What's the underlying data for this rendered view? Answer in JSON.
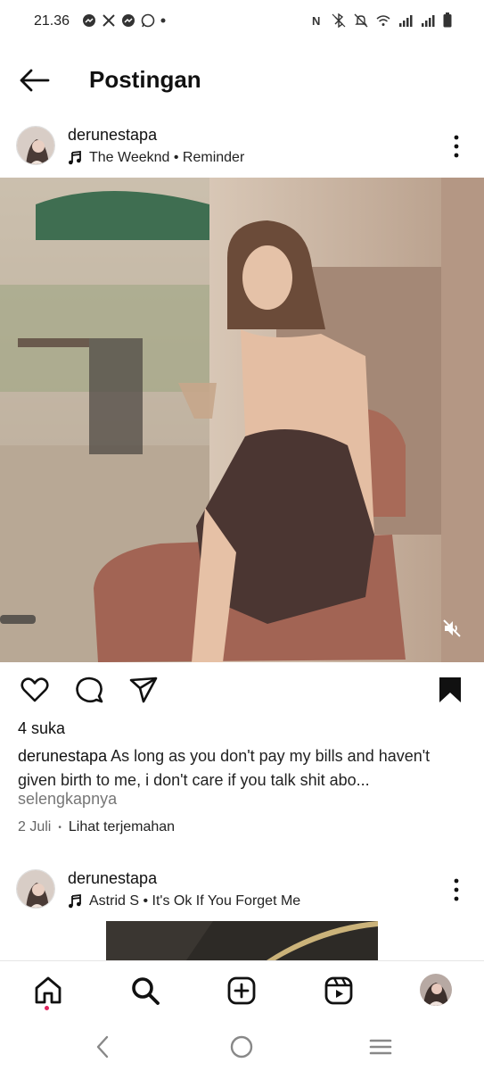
{
  "status_bar": {
    "time": "21.36",
    "left_icons": [
      "messenger-icon",
      "x-icon",
      "messenger-icon",
      "whatsapp-icon",
      "dot-icon"
    ],
    "right_icons": [
      "nfc-icon",
      "bluetooth-off-icon",
      "mute-icon",
      "wifi-icon",
      "signal-icon",
      "signal-icon",
      "battery-icon"
    ]
  },
  "header": {
    "title": "Postingan",
    "back_icon": "arrow-left-icon"
  },
  "post1": {
    "username": "derunestapa",
    "music": "The Weeknd • Reminder",
    "media_icon": "volume-off-icon",
    "likes": "4 suka",
    "caption_user": "derunestapa",
    "caption_text": " As long as you don't pay my bills and haven't given birth to me, i don't care if you talk shit abo...",
    "more_label": "selengkapnya",
    "date": "2 Juli",
    "separator": "•",
    "translate_label": "Lihat terjemahan"
  },
  "post2": {
    "username": "derunestapa",
    "music": "Astrid S • It's Ok If You Forget Me"
  },
  "actions": {
    "like_icon": "heart-icon",
    "comment_icon": "comment-icon",
    "share_icon": "send-icon",
    "save_icon": "bookmark-icon"
  },
  "bottom_nav": {
    "items": [
      "home-icon",
      "search-icon",
      "add-post-icon",
      "reels-icon",
      "profile-avatar"
    ],
    "notification_color": "#e0245e"
  },
  "system_nav": {
    "items": [
      "back-chevron-icon",
      "home-circle-icon",
      "recents-icon"
    ]
  }
}
